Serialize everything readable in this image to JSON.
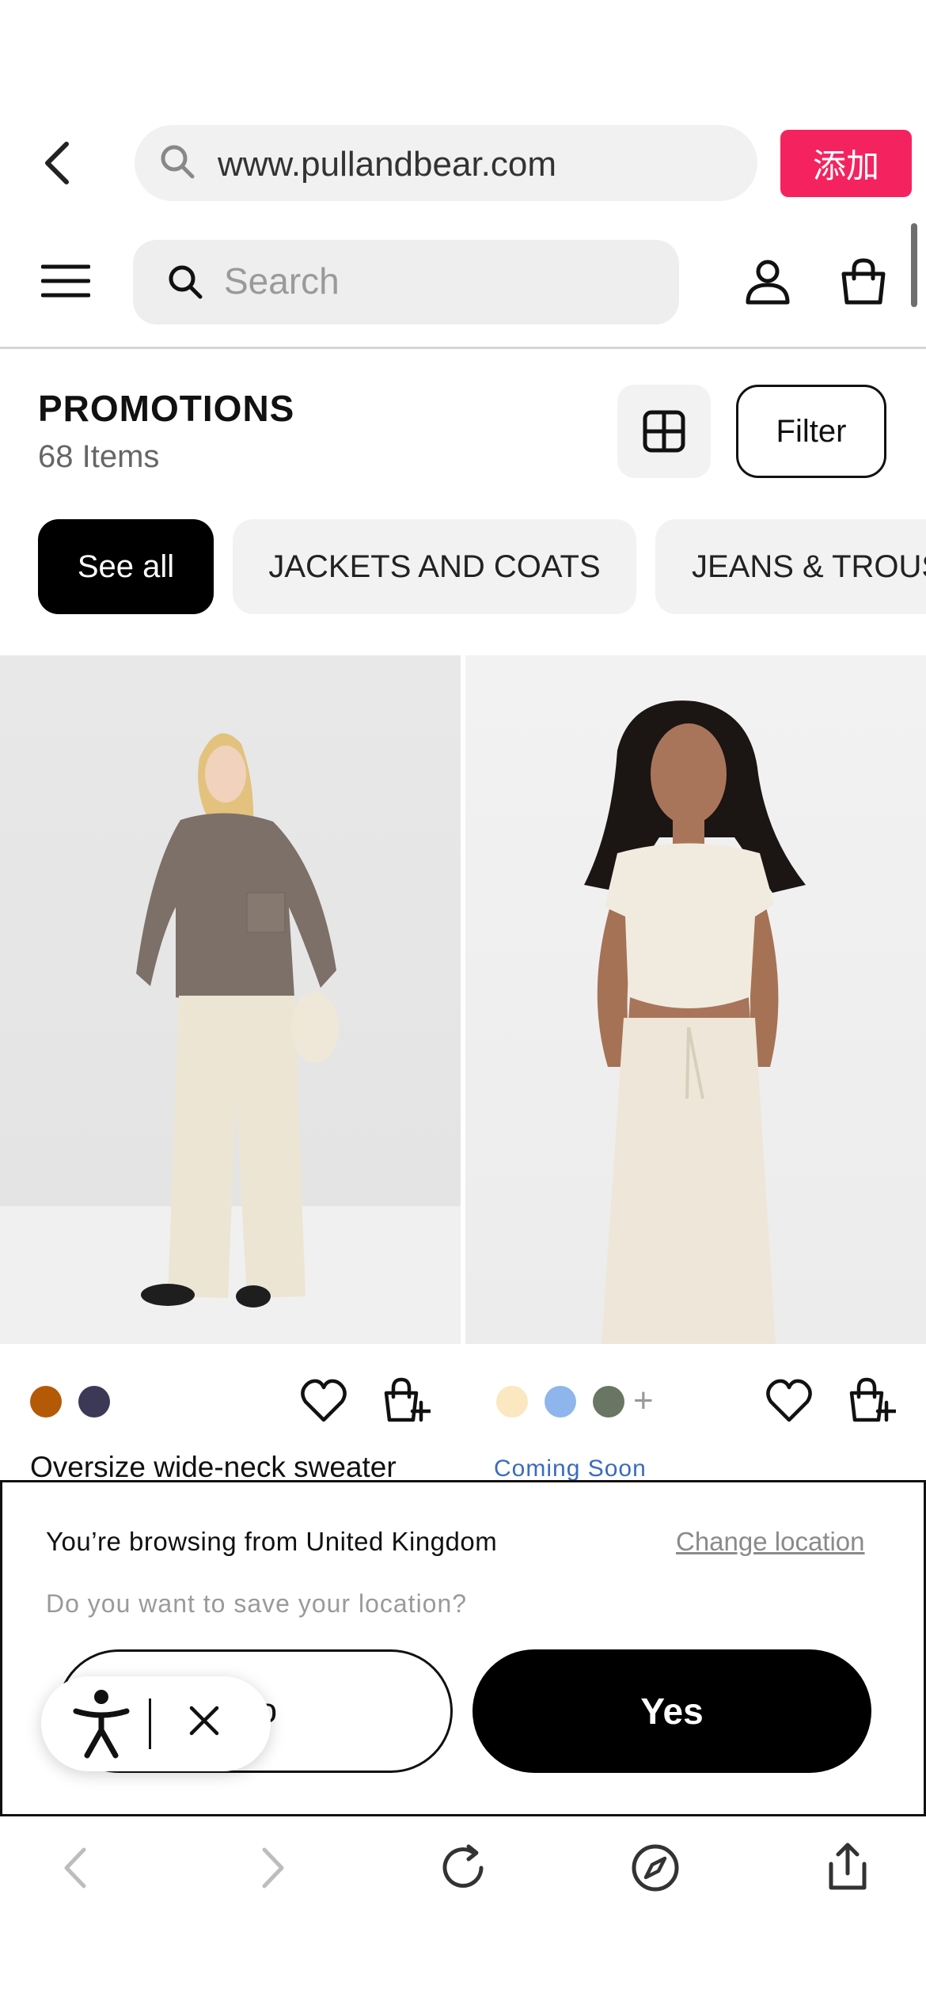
{
  "browser": {
    "url": "www.pullandbear.com",
    "add_label": "添加",
    "accent_color": "#f4235f"
  },
  "header": {
    "search_placeholder": "Search",
    "icons": [
      "menu-icon",
      "search-icon",
      "user-icon",
      "bag-icon"
    ]
  },
  "page": {
    "title": "PROMOTIONS",
    "count": "68 Items",
    "filter_label": "Filter"
  },
  "chips": {
    "all": "See all",
    "jackets": "JACKETS AND COATS",
    "jeans": "JEANS & TROUSERS"
  },
  "products": [
    {
      "name": "Oversize wide-neck sweater",
      "colors": [
        "#b45a06",
        "#3b3955"
      ]
    },
    {
      "badge": "Coming Soon",
      "colors": [
        "#fbe7c0",
        "#8eb6ec",
        "#6a7664"
      ],
      "more_colors": "+"
    }
  ],
  "location_modal": {
    "message": "You’re browsing from United Kingdom",
    "change_link": "Change location",
    "question": "Do you want to save your location?",
    "no_label": "No",
    "yes_label": "Yes"
  },
  "toolbar": {
    "icons": [
      "back-icon",
      "forward-icon",
      "reload-icon",
      "compass-icon",
      "share-icon"
    ]
  }
}
